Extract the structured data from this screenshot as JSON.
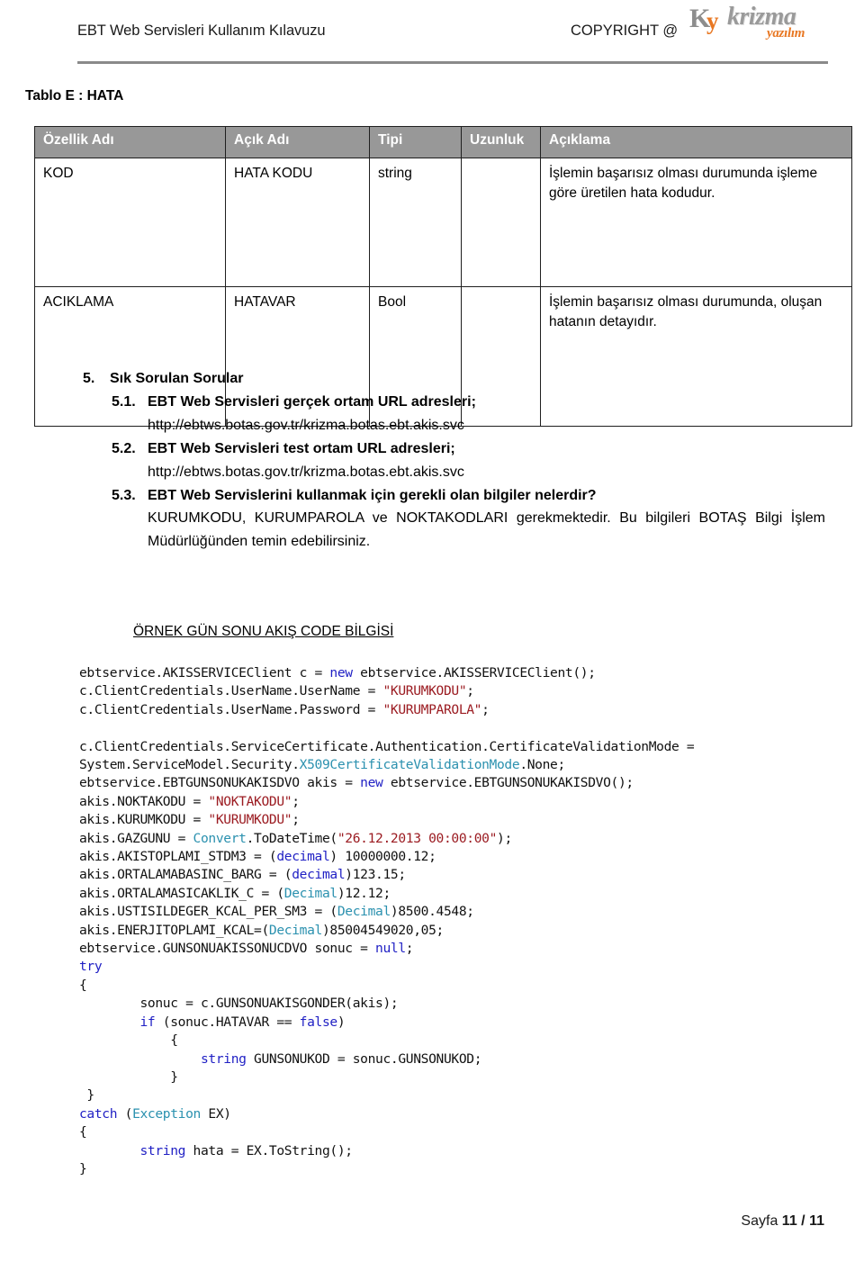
{
  "header": {
    "document_title": "EBT Web Servisleri Kullanım Kılavuzu",
    "copyright": "COPYRIGHT @",
    "logo": {
      "mark_k": "K",
      "mark_y": "y",
      "wordmark": "krizma",
      "tagline": "yazılım"
    }
  },
  "table_section": {
    "caption": "Tablo E : HATA",
    "columns": [
      "Özellik Adı",
      "Açık Adı",
      "Tipi",
      "Uzunluk",
      "Açıklama"
    ],
    "rows": [
      {
        "ozellik_adi": "KOD",
        "acik_adi": "HATA KODU",
        "tipi": "string",
        "uzunluk": "",
        "aciklama": "İşlemin başarısız olması durumunda işleme göre üretilen hata kodudur."
      },
      {
        "ozellik_adi": "ACIKLAMA",
        "acik_adi": "HATAVAR",
        "tipi": "Bool",
        "uzunluk": "",
        "aciklama": "İşlemin başarısız olması durumunda, oluşan hatanın detayıdır."
      }
    ]
  },
  "faq": {
    "section_number": "5.",
    "section_title": "Sık Sorulan Sorular",
    "items": [
      {
        "number": "5.1.",
        "question": "EBT Web Servisleri gerçek ortam URL adresleri;",
        "url": "http://ebtws.botas.gov.tr/krizma.botas.ebt.akis.svc"
      },
      {
        "number": "5.2.",
        "question": "EBT Web Servisleri test ortam URL adresleri;",
        "url": "http://ebtws.botas.gov.tr/krizma.botas.ebt.akis.svc"
      },
      {
        "number": "5.3.",
        "question": "EBT Web Servislerini kullanmak için gerekli olan bilgiler nelerdir?",
        "answer": "KURUMKODU, KURUMPAROLA ve NOKTAKODLARI gerekmektedir. Bu bilgileri BOTAŞ Bilgi İşlem Müdürlüğünden temin edebilirsiniz."
      }
    ]
  },
  "code_sample": {
    "heading": "ÖRNEK GÜN SONU AKIŞ CODE BİLGİSİ",
    "syntax_colors": {
      "keyword": "#1f1fc4",
      "type": "#2b91af",
      "string": "#9b1b21",
      "text": "#111111"
    },
    "lines": [
      [
        {
          "t": "ebtservice.AKISSERVICEClient c = "
        },
        {
          "t": "new",
          "c": "kw"
        },
        {
          "t": " ebtservice.AKISSERVICEClient();"
        }
      ],
      [
        {
          "t": "c.ClientCredentials.UserName.UserName = "
        },
        {
          "t": "\"KURUMKODU\"",
          "c": "str"
        },
        {
          "t": ";"
        }
      ],
      [
        {
          "t": "c.ClientCredentials.UserName.Password = "
        },
        {
          "t": "\"KURUMPAROLA\"",
          "c": "str"
        },
        {
          "t": ";"
        }
      ],
      [],
      [
        {
          "t": "c.ClientCredentials.ServiceCertificate.Authentication.CertificateValidationMode ="
        }
      ],
      [
        {
          "t": "System.ServiceModel.Security."
        },
        {
          "t": "X509CertificateValidationMode",
          "c": "typ"
        },
        {
          "t": ".None;"
        }
      ],
      [
        {
          "t": "ebtservice.EBTGUNSONUKAKISDVO akis = "
        },
        {
          "t": "new",
          "c": "kw"
        },
        {
          "t": " ebtservice.EBTGUNSONUKAKISDVO();"
        }
      ],
      [
        {
          "t": "akis.NOKTAKODU = "
        },
        {
          "t": "\"NOKTAKODU\"",
          "c": "str"
        },
        {
          "t": ";"
        }
      ],
      [
        {
          "t": "akis.KURUMKODU = "
        },
        {
          "t": "\"KURUMKODU\"",
          "c": "str"
        },
        {
          "t": ";"
        }
      ],
      [
        {
          "t": "akis.GAZGUNU = "
        },
        {
          "t": "Convert",
          "c": "typ"
        },
        {
          "t": ".ToDateTime("
        },
        {
          "t": "\"26.12.2013 00:00:00\"",
          "c": "str"
        },
        {
          "t": ");"
        }
      ],
      [
        {
          "t": "akis.AKISTOPLAMI_STDM3 = ("
        },
        {
          "t": "decimal",
          "c": "kw"
        },
        {
          "t": ") 10000000.12;"
        }
      ],
      [
        {
          "t": "akis.ORTALAMABASINC_BARG = ("
        },
        {
          "t": "decimal",
          "c": "kw"
        },
        {
          "t": ")123.15;"
        }
      ],
      [
        {
          "t": "akis.ORTALAMASICAKLIK_C = ("
        },
        {
          "t": "Decimal",
          "c": "typ"
        },
        {
          "t": ")12.12;"
        }
      ],
      [
        {
          "t": "akis.USTISILDEGER_KCAL_PER_SM3 = ("
        },
        {
          "t": "Decimal",
          "c": "typ"
        },
        {
          "t": ")8500.4548;"
        }
      ],
      [
        {
          "t": "akis.ENERJITOPLAMI_KCAL=("
        },
        {
          "t": "Decimal",
          "c": "typ"
        },
        {
          "t": ")85004549020,05;"
        }
      ],
      [
        {
          "t": "ebtservice.GUNSONUAKISSONUCDVO sonuc = "
        },
        {
          "t": "null",
          "c": "kw"
        },
        {
          "t": ";"
        }
      ],
      [
        {
          "t": "try",
          "c": "kw"
        }
      ],
      [
        {
          "t": "{"
        }
      ],
      [
        {
          "t": "        sonuc = c.GUNSONUAKISGONDER(akis);"
        }
      ],
      [
        {
          "t": "        "
        },
        {
          "t": "if",
          "c": "kw"
        },
        {
          "t": " (sonuc.HATAVAR == "
        },
        {
          "t": "false",
          "c": "kw"
        },
        {
          "t": ")"
        }
      ],
      [
        {
          "t": "            {"
        }
      ],
      [
        {
          "t": "                "
        },
        {
          "t": "string",
          "c": "kw"
        },
        {
          "t": " GUNSONUKOD = sonuc.GUNSONUKOD;"
        }
      ],
      [
        {
          "t": "            }"
        }
      ],
      [
        {
          "t": " }"
        }
      ],
      [
        {
          "t": "catch",
          "c": "kw"
        },
        {
          "t": " ("
        },
        {
          "t": "Exception",
          "c": "typ"
        },
        {
          "t": " EX)"
        }
      ],
      [
        {
          "t": "{"
        }
      ],
      [
        {
          "t": "        "
        },
        {
          "t": "string",
          "c": "kw"
        },
        {
          "t": " hata = EX.ToString();"
        }
      ],
      [
        {
          "t": "}"
        }
      ]
    ]
  },
  "footer": {
    "label": "Sayfa",
    "current_page": "11",
    "separator": "/",
    "total_pages": "11"
  }
}
